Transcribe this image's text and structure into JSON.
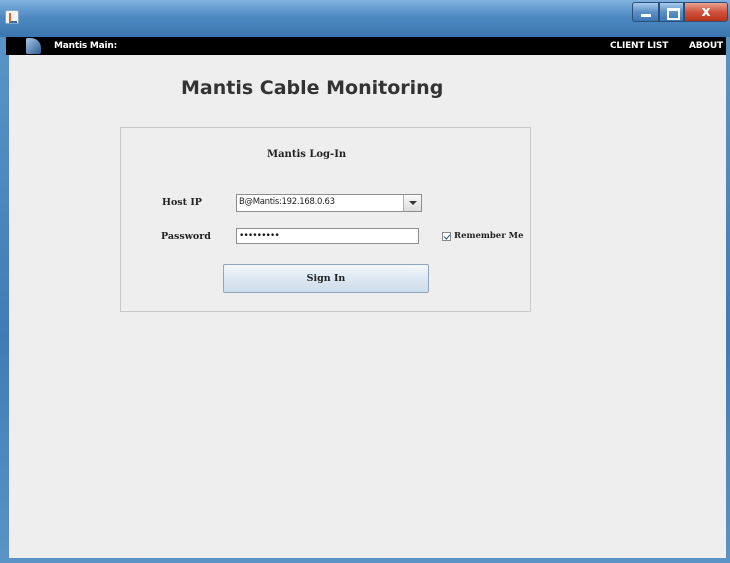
{
  "window": {
    "close_glyph": "x"
  },
  "menu": {
    "title": "Mantis Main:",
    "links": [
      "CLIENT LIST",
      "ABOUT"
    ]
  },
  "page": {
    "heading": "Mantis Cable Monitoring"
  },
  "login": {
    "title": "Mantis Log-In",
    "host_label": "Host IP",
    "host_value": "B@Mantis:192.168.0.63",
    "password_label": "Password",
    "password_mask": "•••••••••",
    "remember_label": "Remember Me",
    "remember_checked": true,
    "signin_label": "Sign In"
  },
  "colors": {
    "menubar": "#000000",
    "content_bg": "#eeeeee",
    "titlebar": "#4e8ac2",
    "close_button": "#d0533b"
  }
}
